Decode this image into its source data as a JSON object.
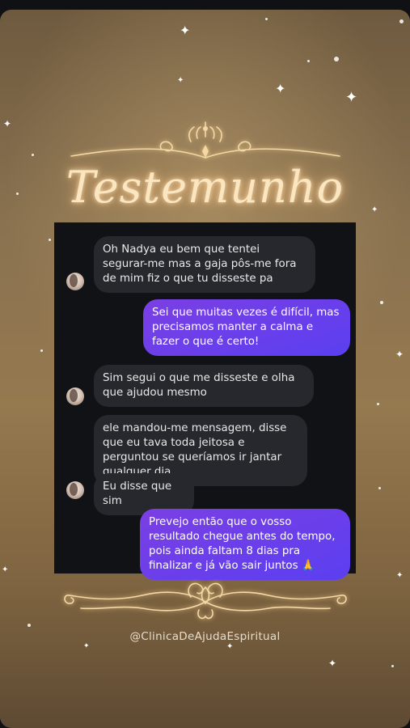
{
  "story": {
    "title": "Testemunho",
    "handle": "@ClinicaDeAjudaEspiritual"
  },
  "chat": {
    "messages": [
      {
        "side": "in",
        "text": "Oh Nadya eu bem que tentei segurar-me mas a gaja pôs-me fora de mim fiz o que tu disseste pa"
      },
      {
        "side": "out",
        "text": "Sei que muitas vezes é difícil, mas precisamos manter a calma e fazer o que é certo!"
      },
      {
        "side": "in",
        "text": "Sim segui o que me disseste e olha que ajudou mesmo"
      },
      {
        "side": "in",
        "text": "ele mandou-me mensagem, disse que eu tava toda jeitosa e perguntou se queríamos ir jantar qualquer dia"
      },
      {
        "side": "in",
        "text": "Eu disse que sim"
      },
      {
        "side": "out",
        "text": "Prevejo então que o vosso resultado chegue antes do tempo, pois ainda faltam 8 dias pra finalizar e já vão sair juntos 🙏"
      }
    ]
  },
  "colors": {
    "outgoing_bubble": "#6a3fe8",
    "incoming_bubble": "#26282d",
    "chat_background": "#111215",
    "title_glow": "#fbe6c2"
  },
  "icons": [
    "avatar",
    "sparkle-icon",
    "ornament-top-icon",
    "ornament-bottom-icon"
  ]
}
